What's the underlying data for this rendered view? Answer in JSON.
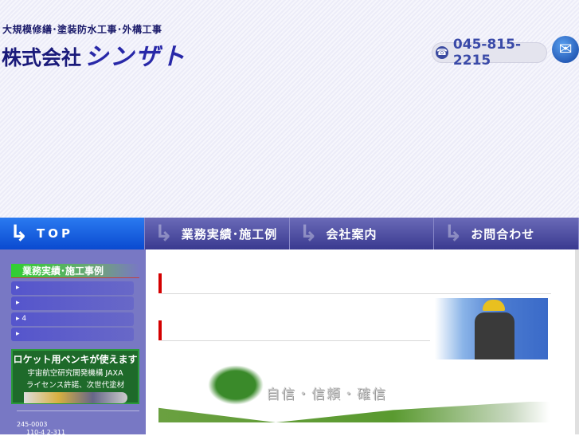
{
  "header": {
    "tagline": "大規模修繕･塗装防水工事･外構工事",
    "company_prefix": "株式会社",
    "company_name": "シンザト",
    "phone": "045-815-2215"
  },
  "nav": [
    {
      "label": "TOP"
    },
    {
      "label": "業務実績･施工例"
    },
    {
      "label": "会社案内"
    },
    {
      "label": "お問合わせ"
    }
  ],
  "sidebar": {
    "heading": "業務実績･施工事例",
    "items": [
      {
        "label": ""
      },
      {
        "label": ""
      },
      {
        "label": "4"
      },
      {
        "label": ""
      }
    ],
    "banner": {
      "title": "ロケット用ペンキが使えます",
      "line1": "宇宙航空研究開発機構 JAXA",
      "line2": "ライセンス許諾、次世代塗材"
    },
    "address_line1": "245-0003",
    "address_line2": "110-4 2-311"
  },
  "main": {
    "motto": "自信・信頼・確信"
  }
}
